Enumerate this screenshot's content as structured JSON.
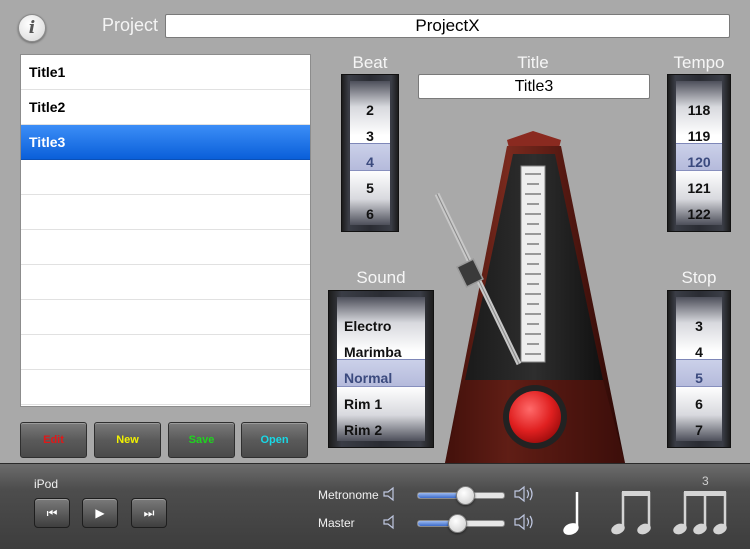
{
  "header": {
    "info_icon": "i",
    "project_label": "Project",
    "project_name": "ProjectX"
  },
  "titles": [
    "Title1",
    "Title2",
    "Title3"
  ],
  "selected_title_index": 2,
  "buttons": {
    "edit": {
      "label": "Edit",
      "color": "#e01818"
    },
    "new": {
      "label": "New",
      "color": "#f2f200"
    },
    "save": {
      "label": "Save",
      "color": "#1fd41f"
    },
    "open": {
      "label": "Open",
      "color": "#19d8e6"
    }
  },
  "beat": {
    "label": "Beat",
    "values": [
      "2",
      "3",
      "4",
      "5",
      "6"
    ],
    "selected": "4"
  },
  "title": {
    "label": "Title",
    "value": "Title3"
  },
  "tempo": {
    "label": "Tempo",
    "values": [
      "118",
      "119",
      "120",
      "121",
      "122"
    ],
    "selected": "120"
  },
  "sound": {
    "label": "Sound",
    "values": [
      "Electro",
      "Marimba",
      "Normal",
      "Rim 1",
      "Rim 2"
    ],
    "selected": "Normal"
  },
  "stop": {
    "label": "Stop",
    "values": [
      "3",
      "4",
      "5",
      "6",
      "7"
    ],
    "selected": "5"
  },
  "ipod": {
    "label": "iPod",
    "prev_icon": "⏮",
    "play_icon": "▶",
    "next_icon": "⏭"
  },
  "volume": {
    "metronome_label": "Metronome",
    "metronome_level": 0.55,
    "master_label": "Master",
    "master_level": 0.45
  },
  "note_selector": {
    "count_label": "3",
    "notes": [
      "quarter-note",
      "eighth-notes",
      "triplet-notes"
    ]
  },
  "colors": {
    "selection_blue": "#1a6fe0",
    "metronome_wood": "#5c1c14",
    "start_button": "#e02020"
  }
}
